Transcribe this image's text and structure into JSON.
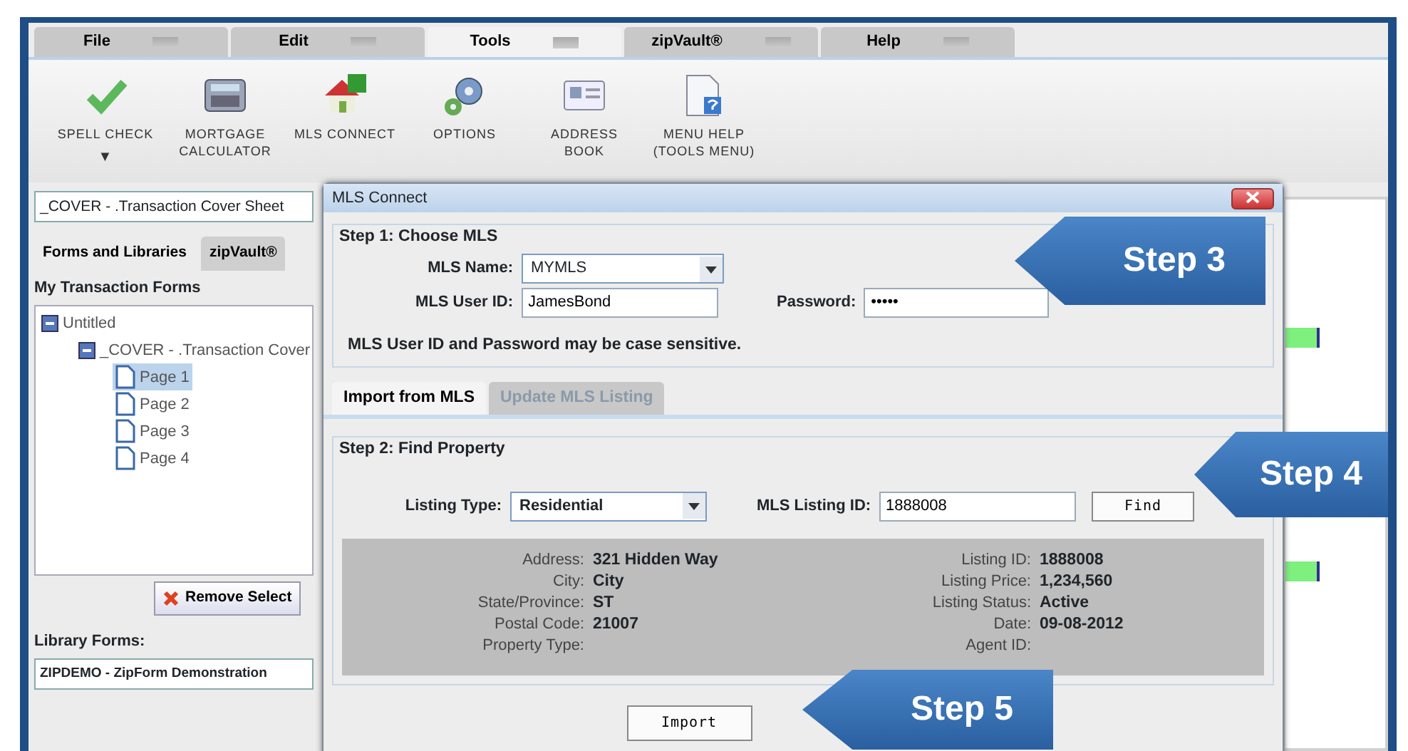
{
  "menu_tabs": [
    {
      "label": "File",
      "selected": false
    },
    {
      "label": "Edit",
      "selected": false
    },
    {
      "label": "Tools",
      "selected": true
    },
    {
      "label": "zipVault®",
      "selected": false
    },
    {
      "label": "Help",
      "selected": false
    }
  ],
  "toolbar": [
    {
      "kind": "spellcheck",
      "label": "SPELL CHECK",
      "menu_arrow": "▼"
    },
    {
      "kind": "calculator",
      "label": "MORTGAGE\nCALCULATOR"
    },
    {
      "kind": "house",
      "label": "MLS CONNECT"
    },
    {
      "kind": "gears",
      "label": "OPTIONS"
    },
    {
      "kind": "card",
      "label": "ADDRESS\nBOOK"
    },
    {
      "kind": "helpdoc",
      "label": "MENU HELP\n(TOOLS MENU)"
    }
  ],
  "left_panel": {
    "document_select": "_COVER - .Transaction Cover Sheet",
    "tabs": [
      {
        "label": "Forms and Libraries",
        "selected": true
      },
      {
        "label": "zipVault®",
        "selected": false
      }
    ],
    "section_title": "My Transaction Forms",
    "tree": [
      {
        "label": "Untitled",
        "kind": "folder",
        "selected": false,
        "children": [
          {
            "label": "_COVER - .Transaction Cover",
            "kind": "folder",
            "selected": false,
            "children": [
              {
                "label": "Page 1",
                "kind": "page",
                "selected": true
              },
              {
                "label": "Page 2",
                "kind": "page",
                "selected": false
              },
              {
                "label": "Page 3",
                "kind": "page",
                "selected": false
              },
              {
                "label": "Page 4",
                "kind": "page",
                "selected": false
              }
            ]
          }
        ]
      }
    ],
    "remove_button": "Remove Select",
    "library_label": "Library Forms:",
    "library_select": "ZIPDEMO - ZipForm Demonstration"
  },
  "dialog": {
    "title": "MLS Connect",
    "step1": {
      "legend": "Step 1: Choose MLS",
      "mls_name_label": "MLS Name:",
      "mls_name": "MYMLS",
      "user_id_label": "MLS User ID:",
      "user_id": "JamesBond",
      "password_label": "Password:",
      "password": "•••••",
      "note": "MLS User ID and Password may be case sensitive."
    },
    "tabs": [
      {
        "label": "Import from MLS",
        "selected": true,
        "disabled": false
      },
      {
        "label": "Update MLS Listing",
        "selected": false,
        "disabled": true
      }
    ],
    "step2": {
      "legend": "Step 2: Find Property",
      "listing_type_label": "Listing Type:",
      "listing_type": "Residential",
      "listing_id_label": "MLS Listing ID:",
      "listing_id": "1888008",
      "find_button": "Find"
    },
    "details_left": [
      {
        "label": "Address:",
        "value": "321 Hidden Way"
      },
      {
        "label": "City:",
        "value": "City"
      },
      {
        "label": "State/Province:",
        "value": "ST"
      },
      {
        "label": "Postal Code:",
        "value": "21007"
      },
      {
        "label": "Property Type:"
      }
    ],
    "details_right": [
      {
        "label": "Listing ID:",
        "value": "1888008"
      },
      {
        "label": "Listing Price:",
        "value": "1,234,560"
      },
      {
        "label": "Listing Status:",
        "value": "Active"
      },
      {
        "label": "Date:",
        "value": "09-08-2012"
      },
      {
        "label": "Agent ID:"
      }
    ],
    "import_button": "Import"
  },
  "callouts": [
    {
      "label": "Step 3"
    },
    {
      "label": "Step 4"
    },
    {
      "label": "Step 5"
    }
  ]
}
